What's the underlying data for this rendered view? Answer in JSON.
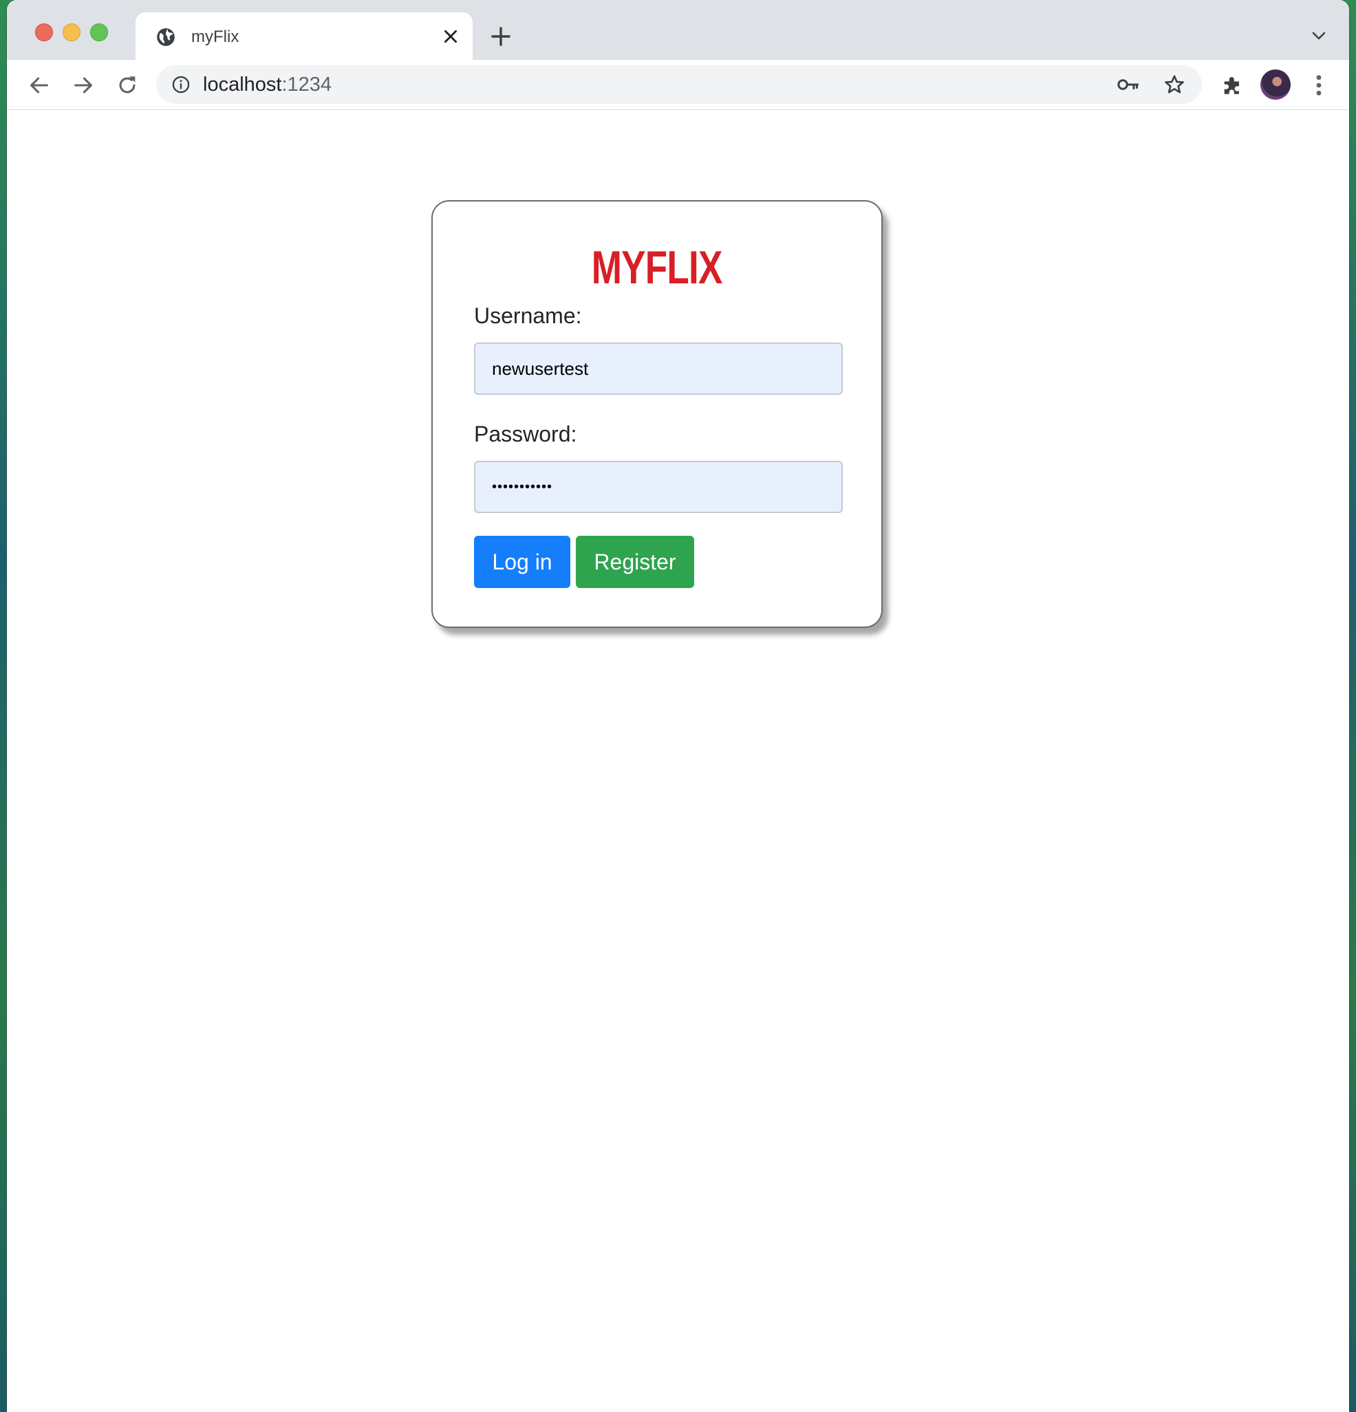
{
  "browser": {
    "tab_title": "myFlix",
    "url_host": "localhost",
    "url_port": ":1234"
  },
  "icons": {
    "favicon": "globe-icon",
    "tab_close": "close-icon",
    "new_tab": "plus-icon",
    "tab_list": "chevron-down-icon",
    "back": "arrow-left-icon",
    "forward": "arrow-right-icon",
    "reload": "reload-icon",
    "site_info": "info-icon",
    "passwords": "key-icon",
    "bookmark": "star-icon",
    "extensions": "puzzle-icon",
    "menu": "kebab-menu-icon"
  },
  "login": {
    "logo": "MYFLIX",
    "username_label": "Username:",
    "username_value": "newusertest",
    "password_label": "Password:",
    "password_value": "•••••••••••",
    "login_button": "Log in",
    "register_button": "Register"
  },
  "colors": {
    "brand": "#d81f26",
    "login_button": "#157efb",
    "register_button": "#2ea44f",
    "input_autofill_bg": "#e8f0fe"
  }
}
